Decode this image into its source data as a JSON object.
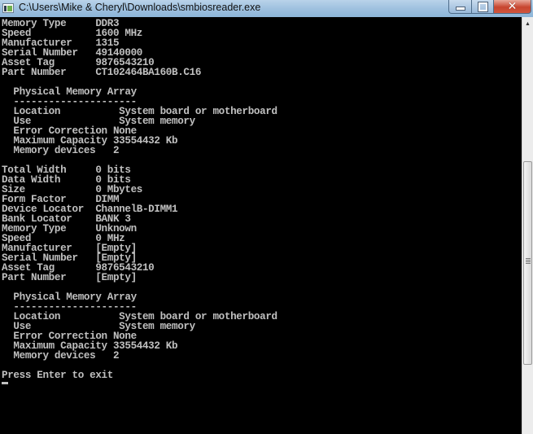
{
  "window": {
    "title": "C:\\Users\\Mike & Cheryl\\Downloads\\smbiosreader.exe",
    "icon": "console-app-icon",
    "buttons": {
      "minimize": "minimize-icon",
      "maximize": "restore-icon",
      "close": "close-icon"
    }
  },
  "console": {
    "lines": [
      "Memory Type     DDR3",
      "Speed           1600 MHz",
      "Manufacturer    1315",
      "Serial Number   49140000",
      "Asset Tag       9876543210",
      "Part Number     CT102464BA160B.C16",
      "",
      "  Physical Memory Array",
      "  ---------------------",
      "  Location          System board or motherboard",
      "  Use               System memory",
      "  Error Correction None",
      "  Maximum Capacity 33554432 Kb",
      "  Memory devices   2",
      "",
      "Total Width     0 bits",
      "Data Width      0 bits",
      "Size            0 Mbytes",
      "Form Factor     DIMM",
      "Device Locator  ChannelB-DIMM1",
      "Bank Locator    BANK 3",
      "Memory Type     Unknown",
      "Speed           0 MHz",
      "Manufacturer    [Empty]",
      "Serial Number   [Empty]",
      "Asset Tag       9876543210",
      "Part Number     [Empty]",
      "",
      "  Physical Memory Array",
      "  ---------------------",
      "  Location          System board or motherboard",
      "  Use               System memory",
      "  Error Correction None",
      "  Maximum Capacity 33554432 Kb",
      "  Memory devices   2",
      "",
      "Press Enter to exit"
    ]
  },
  "scrollbar": {
    "up_arrow": "▲",
    "position_fraction": 0.36
  }
}
